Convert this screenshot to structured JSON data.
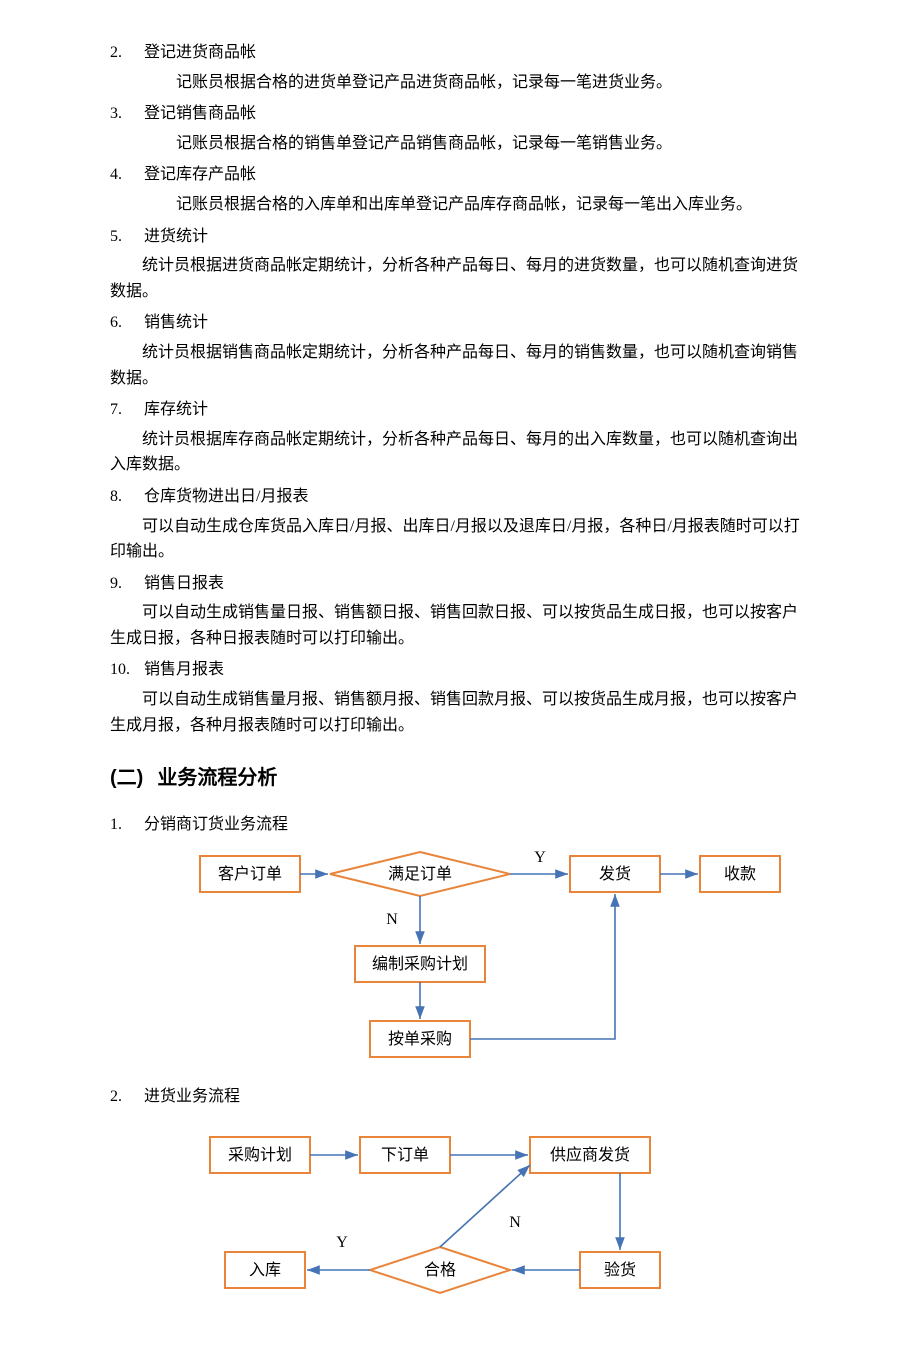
{
  "numbered_items": [
    {
      "num": "2.",
      "title": "登记进货商品帐",
      "desc": "记账员根据合格的进货单登记产品进货商品帐，记录每一笔进货业务。"
    },
    {
      "num": "3.",
      "title": "登记销售商品帐",
      "desc": "记账员根据合格的销售单登记产品销售商品帐，记录每一笔销售业务。"
    },
    {
      "num": "4.",
      "title": "登记库存产品帐",
      "desc": "记账员根据合格的入库单和出库单登记产品库存商品帐，记录每一笔出入库业务。"
    },
    {
      "num": "5.",
      "title": "进货统计",
      "desc": "统计员根据进货商品帐定期统计，分析各种产品每日、每月的进货数量，也可以随机查询进货数据。"
    },
    {
      "num": "6.",
      "title": "销售统计",
      "desc": "统计员根据销售商品帐定期统计，分析各种产品每日、每月的销售数量，也可以随机查询销售数据。"
    },
    {
      "num": "7.",
      "title": "库存统计",
      "desc": "统计员根据库存商品帐定期统计，分析各种产品每日、每月的出入库数量，也可以随机查询出入库数据。"
    },
    {
      "num": "8.",
      "title": "仓库货物进出日/月报表",
      "desc": "可以自动生成仓库货品入库日/月报、出库日/月报以及退库日/月报，各种日/月报表随时可以打印输出。"
    },
    {
      "num": "9.",
      "title": "销售日报表",
      "desc": "可以自动生成销售量日报、销售额日报、销售回款日报、可以按货品生成日报，也可以按客户生成日报，各种日报表随时可以打印输出。"
    },
    {
      "num": "10.",
      "title": "销售月报表",
      "desc": "可以自动生成销售量月报、销售额月报、销售回款月报、可以按货品生成月报，也可以按客户生成月报，各种月报表随时可以打印输出。"
    }
  ],
  "section2": {
    "num": "(二)",
    "title": "业务流程分析"
  },
  "flow1": {
    "num": "1.",
    "title": "分销商订货业务流程",
    "nodes": {
      "customer_order": "客户订单",
      "fulfill": "满足订单",
      "ship": "发货",
      "receive": "收款",
      "plan": "编制采购计划",
      "purchase": "按单采购"
    },
    "edges": {
      "yes": "Y",
      "no": "N"
    }
  },
  "flow2": {
    "num": "2.",
    "title": "进货业务流程",
    "nodes": {
      "plan": "采购计划",
      "order": "下订单",
      "supplier_ship": "供应商发货",
      "inspect": "验货",
      "qualified": "合格",
      "receive": "入库"
    },
    "edges": {
      "yes": "Y",
      "no": "N"
    }
  }
}
